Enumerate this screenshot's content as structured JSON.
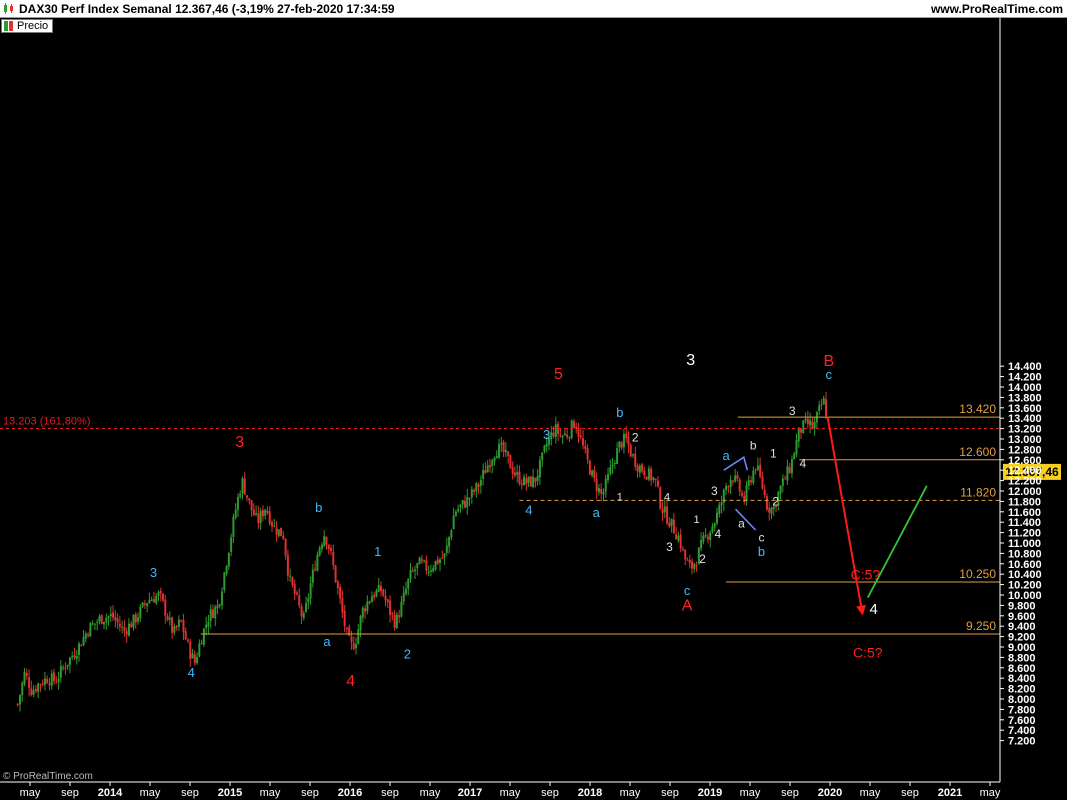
{
  "window": {
    "title": "DAX30 Perf Index Semanal 12.367,46 (-3,19% 27-feb-2020 17:34:59",
    "site": "www.ProRealTime.com",
    "legend_label": "Precio",
    "watermark": "© ProRealTime.com"
  },
  "colors": {
    "background": "#000000",
    "up_candle": "#2e9b2e",
    "down_candle": "#e03030",
    "axis_text": "#ffffff",
    "fib_line": "#e0a040",
    "red_dotted": "#e01c1c",
    "price_tag_bg": "#f5d020",
    "red_arrow": "#ff1a1a",
    "green_arrow": "#36c436",
    "blue_lines": "#6e8cff"
  },
  "chart_data": {
    "type": "candlestick",
    "title": "DAX30 Perf Index Semanal",
    "last_price": "12.367,46",
    "change": "-3,19%",
    "timestamp": "27-feb-2020 17:34:59",
    "ylim": [
      7000,
      14500
    ],
    "y_ticks": [
      "14.400",
      "14.200",
      "14.000",
      "13.800",
      "13.600",
      "13.400",
      "13.200",
      "13.000",
      "12.800",
      "12.600",
      "12.400",
      "12.200",
      "12.000",
      "11.800",
      "11.600",
      "11.400",
      "11.200",
      "11.000",
      "10.800",
      "10.600",
      "10.400",
      "10.200",
      "10.000",
      "9.800",
      "9.600",
      "9.400",
      "9.200",
      "9.000",
      "8.800",
      "8.600",
      "8.400",
      "8.200",
      "8.000",
      "7.800",
      "7.600",
      "7.400",
      "7.200"
    ],
    "x_ticks": [
      "may",
      "sep",
      "2014",
      "may",
      "sep",
      "2015",
      "may",
      "sep",
      "2016",
      "sep",
      "may",
      "2017",
      "may",
      "sep",
      "2018",
      "may",
      "sep",
      "2019",
      "may",
      "sep",
      "2020",
      "may",
      "sep",
      "2021",
      "may"
    ],
    "price_path": [
      [
        2013.3,
        7900
      ],
      [
        2013.36,
        8500
      ],
      [
        2013.42,
        8150
      ],
      [
        2013.48,
        8300
      ],
      [
        2013.55,
        8400
      ],
      [
        2013.62,
        8350
      ],
      [
        2013.7,
        8650
      ],
      [
        2013.8,
        8950
      ],
      [
        2013.9,
        9350
      ],
      [
        2014.0,
        9550
      ],
      [
        2014.1,
        9600
      ],
      [
        2014.2,
        9300
      ],
      [
        2014.3,
        9550
      ],
      [
        2014.4,
        9900
      ],
      [
        2014.5,
        10000
      ],
      [
        2014.55,
        9700
      ],
      [
        2014.62,
        9250
      ],
      [
        2014.68,
        9500
      ],
      [
        2014.75,
        8950
      ],
      [
        2014.8,
        8700
      ],
      [
        2014.85,
        9150
      ],
      [
        2014.92,
        9600
      ],
      [
        2015.0,
        9800
      ],
      [
        2015.08,
        10800
      ],
      [
        2015.15,
        11700
      ],
      [
        2015.2,
        12200
      ],
      [
        2015.27,
        11700
      ],
      [
        2015.33,
        11400
      ],
      [
        2015.4,
        11700
      ],
      [
        2015.47,
        11300
      ],
      [
        2015.55,
        11150
      ],
      [
        2015.6,
        10300
      ],
      [
        2015.65,
        10000
      ],
      [
        2015.72,
        9500
      ],
      [
        2015.78,
        10200
      ],
      [
        2015.85,
        10900
      ],
      [
        2015.9,
        11200
      ],
      [
        2015.95,
        10800
      ],
      [
        2016.02,
        10000
      ],
      [
        2016.08,
        9300
      ],
      [
        2016.12,
        9000
      ],
      [
        2016.16,
        9100
      ],
      [
        2016.22,
        9700
      ],
      [
        2016.3,
        10000
      ],
      [
        2016.38,
        10100
      ],
      [
        2016.45,
        9700
      ],
      [
        2016.5,
        9450
      ],
      [
        2016.55,
        9800
      ],
      [
        2016.62,
        10350
      ],
      [
        2016.7,
        10600
      ],
      [
        2016.78,
        10500
      ],
      [
        2016.85,
        10650
      ],
      [
        2016.92,
        10750
      ],
      [
        2017.0,
        11600
      ],
      [
        2017.1,
        11800
      ],
      [
        2017.2,
        12100
      ],
      [
        2017.28,
        12500
      ],
      [
        2017.35,
        12800
      ],
      [
        2017.4,
        12800
      ],
      [
        2017.45,
        12600
      ],
      [
        2017.52,
        12300
      ],
      [
        2017.6,
        12150
      ],
      [
        2017.68,
        12200
      ],
      [
        2017.72,
        12450
      ],
      [
        2017.78,
        12900
      ],
      [
        2017.85,
        13200
      ],
      [
        2017.9,
        13050
      ],
      [
        2017.96,
        13100
      ],
      [
        2018.02,
        13350
      ],
      [
        2018.08,
        12900
      ],
      [
        2018.12,
        12600
      ],
      [
        2018.18,
        12200
      ],
      [
        2018.25,
        11900
      ],
      [
        2018.3,
        12250
      ],
      [
        2018.35,
        12600
      ],
      [
        2018.4,
        12900
      ],
      [
        2018.45,
        13000
      ],
      [
        2018.5,
        12700
      ],
      [
        2018.55,
        12500
      ],
      [
        2018.6,
        12400
      ],
      [
        2018.65,
        12300
      ],
      [
        2018.7,
        12200
      ],
      [
        2018.75,
        11700
      ],
      [
        2018.8,
        11500
      ],
      [
        2018.85,
        11300
      ],
      [
        2018.9,
        11100
      ],
      [
        2018.95,
        10700
      ],
      [
        2019.0,
        10500
      ],
      [
        2019.05,
        10700
      ],
      [
        2019.1,
        11000
      ],
      [
        2019.15,
        11200
      ],
      [
        2019.2,
        11400
      ],
      [
        2019.25,
        11700
      ],
      [
        2019.3,
        12100
      ],
      [
        2019.35,
        12300
      ],
      [
        2019.4,
        12100
      ],
      [
        2019.45,
        11800
      ],
      [
        2019.5,
        12200
      ],
      [
        2019.55,
        12500
      ],
      [
        2019.6,
        12150
      ],
      [
        2019.65,
        11700
      ],
      [
        2019.7,
        11650
      ],
      [
        2019.75,
        12000
      ],
      [
        2019.8,
        12250
      ],
      [
        2019.85,
        12500
      ],
      [
        2019.88,
        12800
      ],
      [
        2019.92,
        13150
      ],
      [
        2019.96,
        13250
      ],
      [
        2020.0,
        13300
      ],
      [
        2020.04,
        13200
      ],
      [
        2020.08,
        13500
      ],
      [
        2020.12,
        13700
      ],
      [
        2020.14,
        13750
      ],
      [
        2020.15,
        13400
      ],
      [
        2020.16,
        12367
      ]
    ],
    "fib_lines": [
      {
        "label": "13.420",
        "value": 13420,
        "x_from": 2019.4,
        "style": "solid"
      },
      {
        "label": "12.600",
        "value": 12600,
        "x_from": 2019.92,
        "style": "solid"
      },
      {
        "label": "11.820",
        "value": 11820,
        "x_from": 2017.55,
        "style": "dashed"
      },
      {
        "label": "10.250",
        "value": 10250,
        "x_from": 2019.3,
        "style": "solid"
      },
      {
        "label": "9.250",
        "value": 9250,
        "x_from": 2014.85,
        "style": "solid"
      }
    ],
    "red_level": {
      "label": "13.203 (161,80%)",
      "value": 13203
    },
    "red_arrow": {
      "from": [
        2020.16,
        13420
      ],
      "to": [
        2020.45,
        9700
      ]
    },
    "green_arrow": {
      "from": [
        2020.5,
        9950
      ],
      "to": [
        2021.0,
        12100
      ]
    },
    "blue_segments": [
      [
        [
          2019.28,
          12400
        ],
        [
          2019.45,
          12650
        ],
        [
          2019.48,
          12400
        ]
      ],
      [
        [
          2019.38,
          11650
        ],
        [
          2019.55,
          11250
        ]
      ]
    ],
    "annotations": [
      {
        "text": "3",
        "x": 2019.0,
        "y": 14420,
        "color": "#ffffff",
        "size": 16
      },
      {
        "text": "5",
        "x": 2017.88,
        "y": 14150,
        "color": "#ff2020",
        "size": 16
      },
      {
        "text": "B",
        "x": 2020.17,
        "y": 14400,
        "color": "#ff2020",
        "size": 16
      },
      {
        "text": "c",
        "x": 2020.17,
        "y": 14150,
        "color": "#40b8ff",
        "size": 13
      },
      {
        "text": "3",
        "x": 2015.18,
        "y": 12850,
        "color": "#ff2020",
        "size": 16
      },
      {
        "text": "3",
        "x": 2017.78,
        "y": 13000,
        "color": "#40b8ff",
        "size": 13
      },
      {
        "text": "b",
        "x": 2018.4,
        "y": 13420,
        "color": "#40b8ff",
        "size": 13
      },
      {
        "text": "2",
        "x": 2018.53,
        "y": 12950,
        "color": "#e0e0e0",
        "size": 12
      },
      {
        "text": "b",
        "x": 2015.85,
        "y": 11600,
        "color": "#40b8ff",
        "size": 13
      },
      {
        "text": "3",
        "x": 2014.45,
        "y": 10350,
        "color": "#40b8ff",
        "size": 13
      },
      {
        "text": "1",
        "x": 2016.35,
        "y": 10750,
        "color": "#40b8ff",
        "size": 13
      },
      {
        "text": "4",
        "x": 2017.63,
        "y": 11550,
        "color": "#40b8ff",
        "size": 13
      },
      {
        "text": "a",
        "x": 2018.2,
        "y": 11500,
        "color": "#40b8ff",
        "size": 13
      },
      {
        "text": "1",
        "x": 2018.4,
        "y": 11820,
        "color": "#e0e0e0",
        "size": 11
      },
      {
        "text": "4",
        "x": 2018.8,
        "y": 11820,
        "color": "#e0e0e0",
        "size": 11
      },
      {
        "text": "1",
        "x": 2019.05,
        "y": 11380,
        "color": "#e0e0e0",
        "size": 11
      },
      {
        "text": "3",
        "x": 2019.2,
        "y": 11920,
        "color": "#e0e0e0",
        "size": 12
      },
      {
        "text": "4",
        "x": 2019.23,
        "y": 11100,
        "color": "#e0e0e0",
        "size": 12
      },
      {
        "text": "2",
        "x": 2019.1,
        "y": 10620,
        "color": "#e0e0e0",
        "size": 12
      },
      {
        "text": "3",
        "x": 2018.82,
        "y": 10850,
        "color": "#e0e0e0",
        "size": 12
      },
      {
        "text": "c",
        "x": 2018.97,
        "y": 10000,
        "color": "#40b8ff",
        "size": 13
      },
      {
        "text": "A",
        "x": 2018.97,
        "y": 9700,
        "color": "#ff2020",
        "size": 16
      },
      {
        "text": "a",
        "x": 2019.3,
        "y": 12600,
        "color": "#40b8ff",
        "size": 13
      },
      {
        "text": "b",
        "x": 2019.53,
        "y": 12800,
        "color": "#e0e0e0",
        "size": 12
      },
      {
        "text": "1",
        "x": 2019.7,
        "y": 12640,
        "color": "#e0e0e0",
        "size": 12
      },
      {
        "text": "a",
        "x": 2019.43,
        "y": 11300,
        "color": "#e0e0e0",
        "size": 12
      },
      {
        "text": "c",
        "x": 2019.6,
        "y": 11030,
        "color": "#e0e0e0",
        "size": 12
      },
      {
        "text": "b",
        "x": 2019.6,
        "y": 10750,
        "color": "#40b8ff",
        "size": 13
      },
      {
        "text": "2",
        "x": 2019.72,
        "y": 11720,
        "color": "#e0e0e0",
        "size": 12
      },
      {
        "text": "3",
        "x": 2019.86,
        "y": 13460,
        "color": "#e0e0e0",
        "size": 12
      },
      {
        "text": "4",
        "x": 2019.95,
        "y": 12450,
        "color": "#e0e0e0",
        "size": 12
      },
      {
        "text": "a",
        "x": 2015.92,
        "y": 9020,
        "color": "#40b8ff",
        "size": 13
      },
      {
        "text": "4",
        "x": 2014.77,
        "y": 8420,
        "color": "#40b8ff",
        "size": 13
      },
      {
        "text": "2",
        "x": 2016.6,
        "y": 8780,
        "color": "#40b8ff",
        "size": 13
      },
      {
        "text": "4",
        "x": 2016.12,
        "y": 8250,
        "color": "#ff2020",
        "size": 16
      },
      {
        "text": "C:5?",
        "x": 2020.48,
        "y": 10300,
        "color": "#ff2020",
        "size": 14
      },
      {
        "text": "4",
        "x": 2020.55,
        "y": 9630,
        "color": "#ffffff",
        "size": 15
      },
      {
        "text": "C:5?",
        "x": 2020.5,
        "y": 8800,
        "color": "#ff2020",
        "size": 14
      }
    ]
  }
}
